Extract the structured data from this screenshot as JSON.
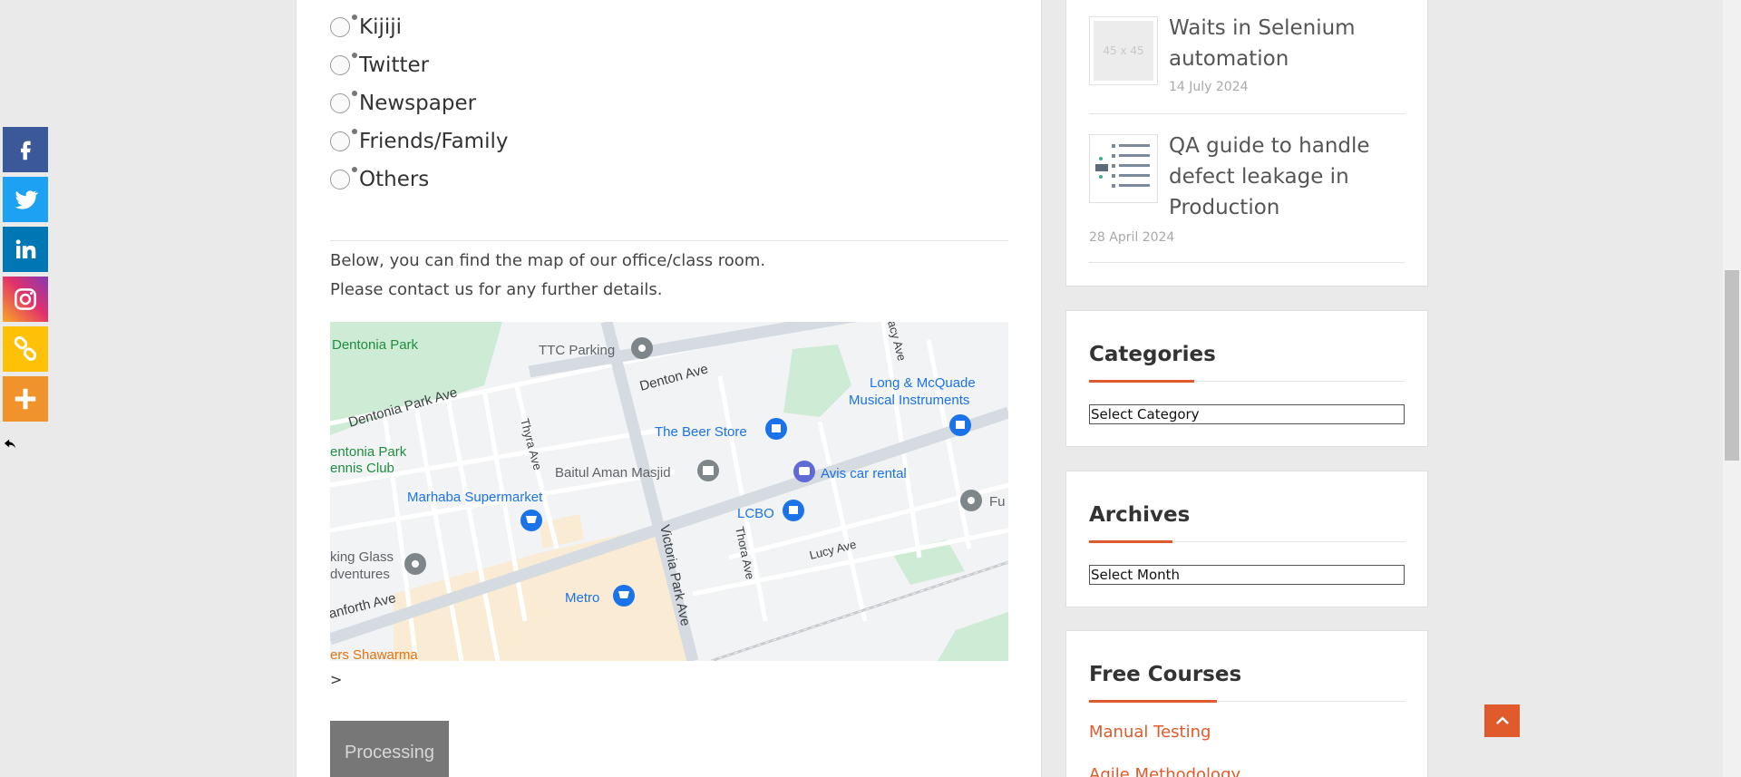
{
  "radio_options": [
    {
      "label": "Kijiji"
    },
    {
      "label": "Twitter"
    },
    {
      "label": "Newspaper"
    },
    {
      "label": "Friends/Family"
    },
    {
      "label": "Others"
    }
  ],
  "map_text": {
    "line1": "Below, you can find the map of our office/class room.",
    "line2": "Please contact us for any further details."
  },
  "map_labels": {
    "dentonia_park": "Dentonia Park",
    "ttc_parking": "TTC Parking",
    "denton_ave": "Denton Ave",
    "dentonia_park_ave": "Dentonia Park Ave",
    "long_mcquade_1": "Long & McQuade",
    "long_mcquade_2": "Musical Instruments",
    "beer_store": "The Beer Store",
    "tennis_1": "entonia Park",
    "tennis_2": "ennis Club",
    "thyra_ave": "Thyra Ave",
    "baitul": "Baitul Aman Masjid",
    "avis": "Avis car rental",
    "marhaba": "Marhaba Supermarket",
    "lcbo": "LCBO",
    "fu": "Fu",
    "thora_ave": "Thora Ave",
    "lucy_ave": "Lucy Ave",
    "victoria_park": "Victoria Park Ave",
    "glass_1": "king Glass",
    "glass_2": "dventures",
    "danforth": "anforth Ave",
    "metro": "Metro",
    "shawarma": "ers Shawarma",
    "acy_ave": "acy Ave"
  },
  "after_map": ">",
  "processing_label": "Processing",
  "sidebar": {
    "posts": [
      {
        "title": "Waits in Selenium automation",
        "date": "14 July 2024",
        "thumb": "45 x 45"
      },
      {
        "title": "QA guide to handle defect leakage in Production",
        "date": "28 April 2024"
      }
    ],
    "categories": {
      "title": "Categories",
      "select": "Select Category"
    },
    "archives": {
      "title": "Archives",
      "select": "Select Month"
    },
    "free_courses": {
      "title": "Free Courses",
      "links": [
        "Manual Testing",
        "Agile Methodology"
      ]
    }
  },
  "share_buttons": [
    {
      "icon": "facebook-icon",
      "color": "#3b5998"
    },
    {
      "icon": "twitter-icon",
      "color": "#1da1f2"
    },
    {
      "icon": "linkedin-icon",
      "color": "#0077b5"
    },
    {
      "icon": "instagram-icon",
      "color": "#e1306c"
    },
    {
      "icon": "copy-link-icon",
      "color": "#ffc107"
    },
    {
      "icon": "more-icon",
      "color": "#f0932b"
    }
  ],
  "colors": {
    "accent": "#e05a2b"
  }
}
